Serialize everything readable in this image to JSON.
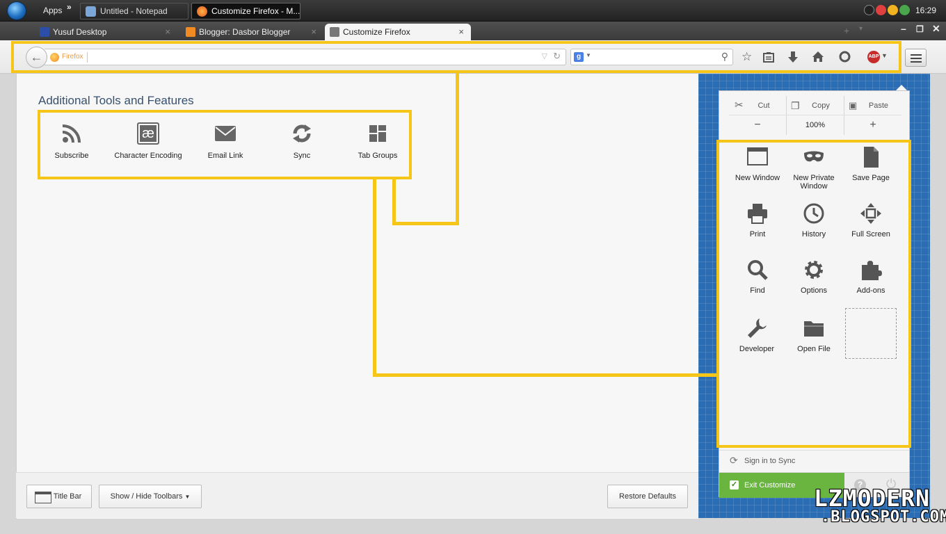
{
  "taskbar": {
    "apps_label": "Apps",
    "overflow": "»",
    "tasks": [
      {
        "title": "Untitled - Notepad"
      },
      {
        "title": "Customize Firefox - M..."
      }
    ],
    "clock": "16:29"
  },
  "browser": {
    "tabs": [
      {
        "title": "Yusuf Desktop",
        "close": "×"
      },
      {
        "title": "Blogger: Dasbor Blogger",
        "close": "×"
      },
      {
        "title": "Customize Firefox",
        "close": "×"
      }
    ],
    "window_controls": {
      "minimize": "–",
      "restore": "❐",
      "close": "✕"
    },
    "urlbar": {
      "identity_label": "Firefox",
      "value": ""
    },
    "searchbar": {
      "engine": "g",
      "value": ""
    }
  },
  "palette": {
    "title": "Additional Tools and Features",
    "items": [
      {
        "label": "Subscribe",
        "icon": "rss-icon"
      },
      {
        "label": "Character Encoding",
        "icon": "character-encoding-icon",
        "glyph": "æ"
      },
      {
        "label": "Email Link",
        "icon": "envelope-icon"
      },
      {
        "label": "Sync",
        "icon": "sync-icon"
      },
      {
        "label": "Tab Groups",
        "icon": "tab-groups-icon"
      }
    ]
  },
  "footer": {
    "title_bar": "Title Bar",
    "toolbars": "Show / Hide Toolbars",
    "restore_defaults": "Restore Defaults"
  },
  "menu_panel": {
    "edit": {
      "cut": "Cut",
      "copy": "Copy",
      "paste": "Paste"
    },
    "zoom": {
      "out": "−",
      "level": "100%",
      "in": "+"
    },
    "items": [
      {
        "label": "New Window",
        "icon": "new-window-icon"
      },
      {
        "label": "New Private Window",
        "icon": "private-mask-icon"
      },
      {
        "label": "Save Page",
        "icon": "save-page-icon"
      },
      {
        "label": "Print",
        "icon": "printer-icon"
      },
      {
        "label": "History",
        "icon": "history-clock-icon"
      },
      {
        "label": "Full Screen",
        "icon": "full-screen-icon"
      },
      {
        "label": "Find",
        "icon": "magnifier-icon"
      },
      {
        "label": "Options",
        "icon": "gear-icon"
      },
      {
        "label": "Add-ons",
        "icon": "puzzle-icon"
      },
      {
        "label": "Developer",
        "icon": "wrench-icon"
      },
      {
        "label": "Open File",
        "icon": "folder-icon"
      }
    ],
    "sign_in": "Sign in to Sync",
    "exit_customize": "Exit Customize",
    "help": "?"
  },
  "watermark": {
    "line1": "LZMODERN",
    "line2": ".BLOGSPOT.COM"
  },
  "colors": {
    "highlight": "#f5c518",
    "exit_green": "#6ab53f",
    "blueprint": "#2a6db4"
  }
}
